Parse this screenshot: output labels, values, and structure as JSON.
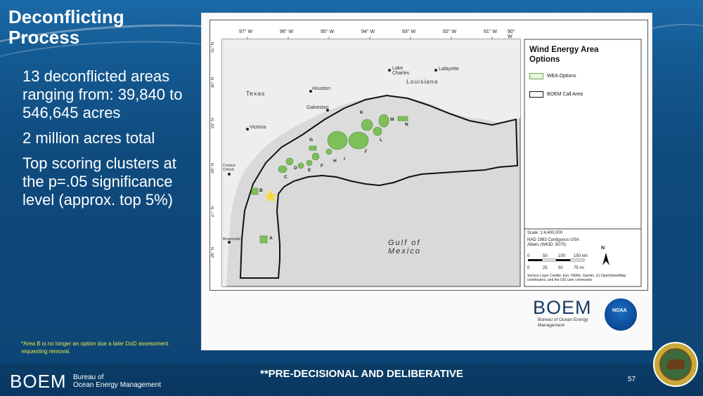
{
  "slide": {
    "title_line1": "Deconflicting",
    "title_line2": "Process",
    "bullets": [
      "13 deconflicted areas ranging from: 39,840 to 546,645 acres",
      "2 million acres total",
      "Top scoring clusters at the p=.05 significance level (approx. top 5%)"
    ],
    "footnote": "*Area B is no longer an option due a later DoD assessment requesting removal.",
    "footer_notice": "**PRE-DECISIONAL AND DELIBERATIVE",
    "page_number": "57",
    "footer_logo": {
      "name": "BOEM",
      "sub1": "Bureau of",
      "sub2": "Ocean Energy Management"
    },
    "seal_icon": "department-seal-icon"
  },
  "map": {
    "legend": {
      "title_line1": "Wind Energy Area",
      "title_line2": "Options",
      "items": [
        {
          "label": "WEA Options",
          "swatch": "#6aa84f"
        },
        {
          "label": "BOEM Call Area",
          "swatch": "#111111"
        }
      ]
    },
    "scale": {
      "line1": "Scale: 1:4,400,000",
      "line2": "NAD 1983 Contiguous USA",
      "line3": "Albers (WKID: 5070)",
      "north": "N",
      "ticks_top": [
        "0",
        "50",
        "100",
        "150 km"
      ],
      "ticks_bottom": [
        "0",
        "25",
        "50",
        "75 mi"
      ],
      "credits": "Service Layer Credits: Esri, HERE, Garmin, (c) OpenStreetMap contributors, and the GIS user community"
    },
    "lon_labels": [
      "97° W",
      "96° W",
      "95° W",
      "94° W",
      "93° W",
      "92° W",
      "91° W",
      "90° W"
    ],
    "lat_labels": [
      "31° N",
      "30° N",
      "29° N",
      "28° N",
      "27° N",
      "26° N"
    ],
    "places": {
      "texas": "Texas",
      "louisiana": "Louisiana",
      "lake_charles": "Lake Charles",
      "lafayette": "Lafayette",
      "houston": "Houston",
      "galveston": "Galveston",
      "victoria": "Victoria",
      "corpus": "Corpus Christi",
      "brownsville": "Brownsville",
      "gulf": "Gulf of Mexico"
    },
    "area_letters": [
      "A",
      "B",
      "C",
      "D",
      "E",
      "F",
      "G",
      "H",
      "I",
      "J",
      "K",
      "L",
      "M",
      "N"
    ],
    "logo_boem": "BOEM",
    "logo_boem_sub1": "Bureau of Ocean Energy",
    "logo_boem_sub2": "Management",
    "logo_noaa": "NOAA"
  },
  "colors": {
    "accent": "#0f4a7d",
    "wea_green": "#6aa84f",
    "footnote": "#e3e84a"
  }
}
